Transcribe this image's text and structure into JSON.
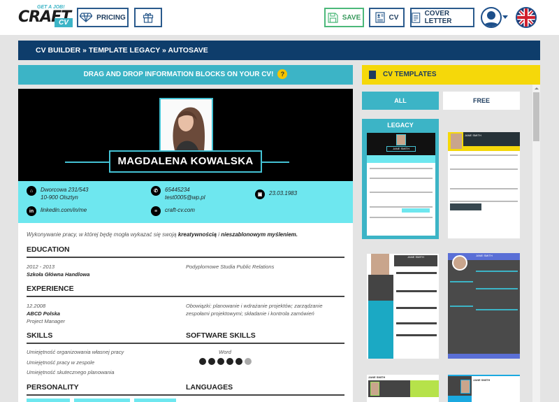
{
  "topbar": {
    "logo": {
      "main": "CRAFT",
      "tagline": "GET A JOB!",
      "suffix": "CV"
    },
    "pricing_label": "PRICING",
    "gift_icon": "gift-icon",
    "save_label": "SAVE",
    "cv_label": "CV",
    "cover_letter_label": "COVER LETTER",
    "user_icon": "user-avatar-icon",
    "language_icon": "uk-flag-icon"
  },
  "breadcrumb": {
    "text": "CV BUILDER » TEMPLATE LEGACY » AUTOSAVE"
  },
  "editor": {
    "hint": "DRAG AND DROP INFORMATION BLOCKS ON YOUR CV!",
    "help_symbol": "?"
  },
  "cv": {
    "name": "MAGDALENA KOWALSKA",
    "contact": {
      "address_line1": "Dworcowa 231/543",
      "address_line2": "10-900 Olsztyn",
      "phone": "65445234",
      "email": "test0005@wp.pl",
      "birthdate": "23.03.1983",
      "linkedin": "linkedin.com/in/me",
      "website": "craft-cv.com"
    },
    "summary": {
      "prefix": "Wykonywanie pracy, w której będę mogła wykazać się swoją ",
      "bold1": "kreatywnością",
      "middle": " i ",
      "bold2": "nieszablonowym myśleniem."
    },
    "sections": {
      "education": "EDUCATION",
      "experience": "EXPERIENCE",
      "skills": "SKILLS",
      "software_skills": "SOFTWARE SKILLS",
      "personality": "PERSONALITY",
      "languages": "LANGUAGES"
    },
    "education": [
      {
        "dates": "2012 - 2013",
        "school": "Szkoła Główna Handlowa",
        "field": "Podyplomowe Studia Public Relations"
      }
    ],
    "experience": [
      {
        "date": "12.2008",
        "company": "ABCD Polska",
        "position": "Project Manager",
        "description": "Obowiązki: planowanie i wdrażanie projektów; zarządzanie zespołami projektowymi; składanie i kontrola zamówień"
      }
    ],
    "skills": [
      "Umiejętność organizowania własnej pracy",
      "Umiejętność pracy w zespole",
      "Umiejętność skutecznego planowania"
    ],
    "software_skills": [
      {
        "name": "Word",
        "rating": 5,
        "max": 6
      }
    ]
  },
  "templates_panel": {
    "title": "CV TEMPLATES",
    "tabs": [
      {
        "label": "ALL",
        "active": true
      },
      {
        "label": "FREE",
        "active": false
      }
    ],
    "items": [
      {
        "label": "LEGACY",
        "selected": true,
        "sample_name": "JANE SMITH"
      },
      {
        "label": "",
        "selected": false,
        "sample_name": "JANE SMITH"
      },
      {
        "label": "",
        "selected": false,
        "sample_name": "JANE SMITH"
      },
      {
        "label": "",
        "selected": false,
        "sample_name": "JANE SMITH"
      },
      {
        "label": "",
        "selected": false,
        "sample_name": "JANE SMITH"
      },
      {
        "label": "",
        "selected": false,
        "sample_name": "JANE SMITH"
      }
    ]
  },
  "colors": {
    "navy": "#0e3d6b",
    "teal": "#3cb4c6",
    "cyan": "#6ee7ef",
    "yellow": "#f5d80a",
    "save_green": "#4cb87a"
  }
}
